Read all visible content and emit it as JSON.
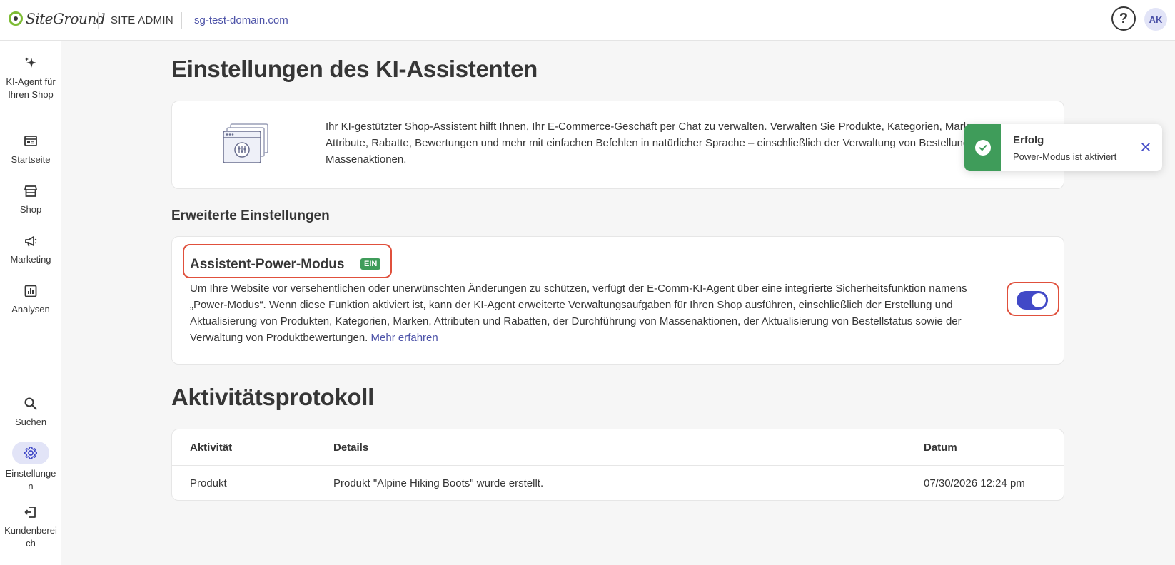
{
  "header": {
    "logo_text": "SiteGround",
    "section": "SITE ADMIN",
    "domain": "sg-test-domain.com",
    "help_label": "?",
    "avatar_initials": "AK"
  },
  "sidebar": {
    "items": [
      {
        "label": "KI-Agent für Ihren Shop",
        "icon": "sparkle-icon"
      },
      {
        "label": "Startseite",
        "icon": "dashboard-icon"
      },
      {
        "label": "Shop",
        "icon": "store-icon"
      },
      {
        "label": "Marketing",
        "icon": "megaphone-icon"
      },
      {
        "label": "Analysen",
        "icon": "chart-icon"
      },
      {
        "label": "Suchen",
        "icon": "search-icon"
      },
      {
        "label": "Einstellungen",
        "icon": "gear-icon",
        "active": true
      },
      {
        "label": "Kundenbereich",
        "icon": "exit-icon"
      }
    ]
  },
  "page": {
    "title": "Einstellungen des KI-Assistenten",
    "intro_lines": [
      "Ihr KI-gestützter Shop-Assistent hilft Ihnen, Ihr E-Commerce-Geschäft per Chat zu verwalten. Verwalten Sie Produkte, Kategorien, Marken,",
      "Attribute, Rabatte, Bewertungen und mehr mit einfachen Befehlen in natürlicher Sprache – einschließlich der Verwaltung von Bestellungen und",
      "Massenaktionen."
    ],
    "advanced_heading": "Erweiterte Einstellungen",
    "power_mode": {
      "title": "Assistent-Power-Modus",
      "badge": "EIN",
      "desc_lines": [
        "Um Ihre Website vor versehentlichen oder unerwünschten Änderungen zu schützen, verfügt der E-Comm-KI-Agent über eine integrierte Sicherheitsfunktion namens",
        "„Power-Modus“. Wenn diese Funktion aktiviert ist, kann der KI-Agent erweiterte Verwaltungsaufgaben für Ihren Shop ausführen, einschließlich der Erstellung und",
        "Aktualisierung von Produkten, Kategorien, Marken, Attributen und Rabatten, der Durchführung von Massenaktionen, der Aktualisierung von Bestellstatus sowie der",
        "Verwaltung von Produktbewertungen."
      ],
      "more_link": "Mehr erfahren",
      "enabled": true
    },
    "activity_heading": "Aktivitätsprotokoll",
    "activity_table": {
      "columns": [
        "Aktivität",
        "Details",
        "Datum"
      ],
      "rows": [
        [
          "Produkt",
          "Produkt \"Alpine Hiking Boots\" wurde erstellt.",
          "07/30/2026 12:24 pm"
        ]
      ]
    }
  },
  "toast": {
    "title": "Erfolg",
    "message": "Power-Modus ist aktiviert"
  },
  "colors": {
    "accent": "#4149c7",
    "success": "#3f9c5a",
    "highlight": "#e0503c",
    "link": "#4d53a8"
  }
}
